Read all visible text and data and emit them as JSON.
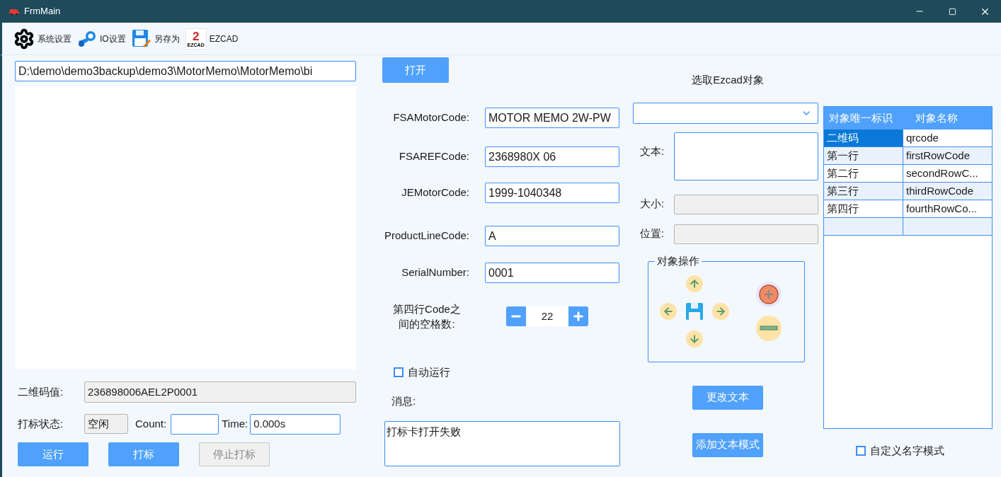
{
  "window": {
    "title": "FrmMain"
  },
  "toolbar": [
    {
      "kind": "gear",
      "label": "系统设置"
    },
    {
      "kind": "io",
      "label": "IO设置"
    },
    {
      "kind": "save",
      "label": "另存为"
    },
    {
      "kind": "ezcad",
      "label": "EZCAD",
      "logo_digit": "2",
      "logo_text": "EZCAD"
    }
  ],
  "path_field": {
    "value": "D:\\demo\\demo3backup\\demo3\\MotorMemo\\MotorMemo\\bi"
  },
  "open_button": {
    "label": "打开"
  },
  "qr_value": {
    "label": "二维码值:",
    "value": "236898006AEL2P0001"
  },
  "status": {
    "label": "打标状态:",
    "value": "空闲",
    "count_label": "Count:",
    "time_label": "Time:",
    "time_value": "0.000s"
  },
  "buttons": [
    {
      "label": "运行",
      "disabled": false
    },
    {
      "label": "打标",
      "disabled": false
    },
    {
      "label": "停止打标",
      "disabled": true
    }
  ],
  "form_fields": [
    {
      "label": "FSAMotorCode:",
      "value": "MOTOR MEMO 2W-PW"
    },
    {
      "label": "FSAREFCode:",
      "value": "2368980X 06"
    },
    {
      "label": "JEMotorCode:",
      "value": "1999-1040348"
    },
    {
      "label": "ProductLineCode:",
      "value": "A"
    },
    {
      "label": "SerialNumber:",
      "value": "0001"
    }
  ],
  "spacing": {
    "label": "第四行Code之间的空格数:",
    "value": "22"
  },
  "auto_run": {
    "label": "自动运行",
    "checked": false
  },
  "message": {
    "label": "消息:",
    "value": "打标卡打开失败"
  },
  "object_panel": {
    "title": "选取Ezcad对象",
    "text_label": "文本:",
    "size_label": "大小:",
    "position_label": "位置:",
    "group_title": "对象操作",
    "buttons": [
      "更改文本",
      "添加文本模式"
    ]
  },
  "table": {
    "columns": [
      "对象唯一标识",
      "对象名称"
    ],
    "rows": [
      {
        "cells": [
          "二维码",
          "qrcode"
        ],
        "selected": true
      },
      {
        "cells": [
          "第一行",
          "firstRowCode"
        ],
        "selected": false
      },
      {
        "cells": [
          "第二行",
          "secondRowC..."
        ],
        "selected": false
      },
      {
        "cells": [
          "第三行",
          "thirdRowCode"
        ],
        "selected": false
      },
      {
        "cells": [
          "第四行",
          "fourthRowCo..."
        ],
        "selected": false
      }
    ]
  },
  "custom_name_mode": {
    "label": "自定义名字模式",
    "checked": false
  }
}
